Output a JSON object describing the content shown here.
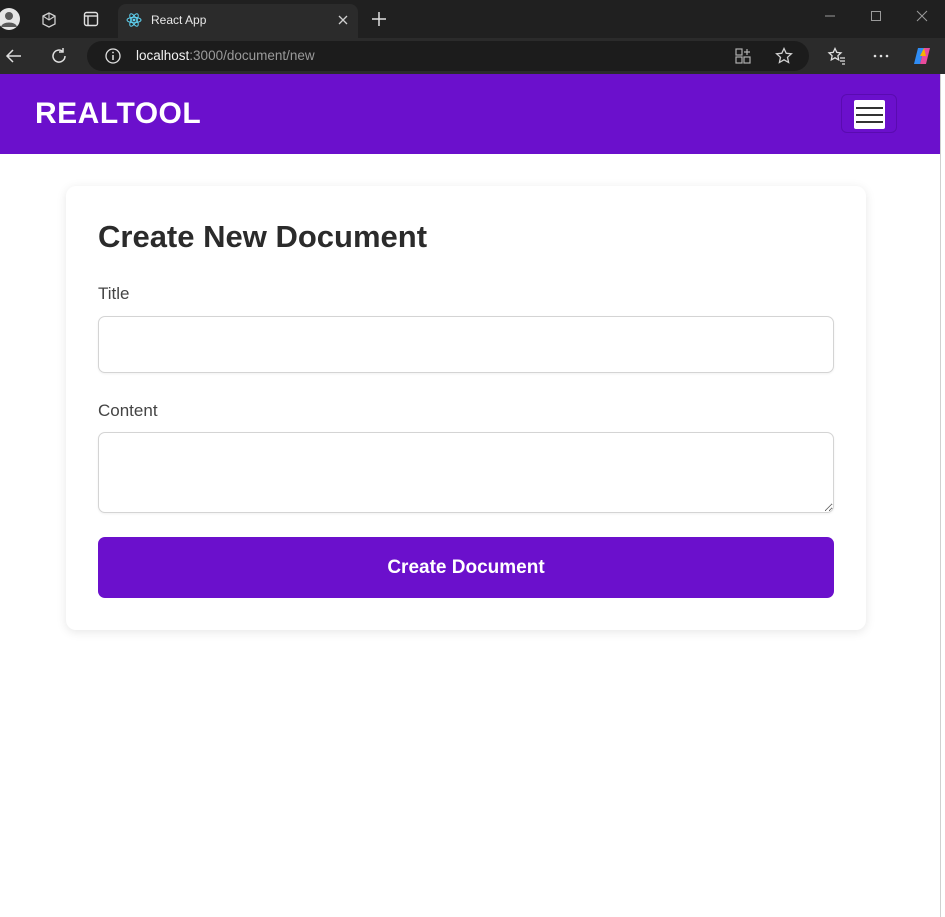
{
  "browser": {
    "tab_title": "React App",
    "url_host": "localhost",
    "url_path": ":3000/document/new",
    "icons": [
      "profile-icon",
      "workspaces-icon",
      "tab-actions-icon",
      "react-favicon",
      "close-icon",
      "plus-icon",
      "minimize-icon",
      "maximize-icon",
      "window-close-icon",
      "back-icon",
      "reload-icon",
      "info-icon",
      "reading-view-icon",
      "favorite-star-icon",
      "favorites-icon",
      "more-icon",
      "copilot-icon"
    ]
  },
  "header": {
    "brand": "REALTOOL",
    "brand_color": "#6b10cc",
    "menu_icon": "hamburger-icon"
  },
  "form": {
    "title": "Create New Document",
    "title_label": "Title",
    "title_value": "",
    "content_label": "Content",
    "content_value": "",
    "submit_label": "Create Document"
  }
}
